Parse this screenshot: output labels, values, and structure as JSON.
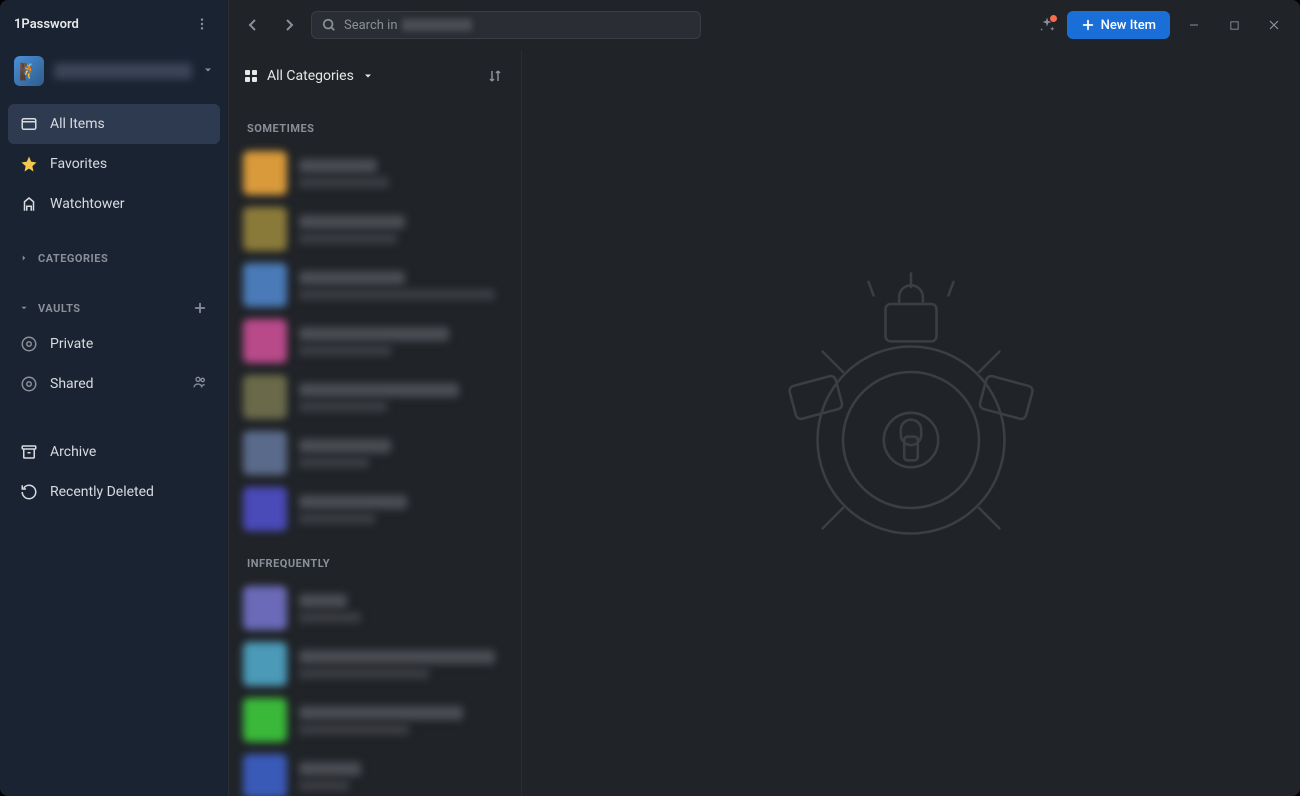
{
  "app_title": "1Password",
  "account_name": "",
  "search_prefix": "Search in",
  "new_item_label": "New Item",
  "nav": {
    "all_items": "All Items",
    "favorites": "Favorites",
    "watchtower": "Watchtower",
    "archive": "Archive",
    "recently_deleted": "Recently Deleted"
  },
  "sections": {
    "categories": "CATEGORIES",
    "vaults": "VAULTS"
  },
  "vaults": {
    "private": "Private",
    "shared": "Shared"
  },
  "list_header": {
    "category": "All Categories"
  },
  "groups": [
    {
      "label": "SOMETIMES",
      "items": [
        {
          "icon_color": "#d89a3a",
          "title_w": 78,
          "sub_w": 90
        },
        {
          "icon_color": "#8a7a3a",
          "title_w": 106,
          "sub_w": 98
        },
        {
          "icon_color": "#4a7ab8",
          "title_w": 106,
          "sub_w": 196
        },
        {
          "icon_color": "#b84a8a",
          "title_w": 150,
          "sub_w": 92
        },
        {
          "icon_color": "#6a6a4a",
          "title_w": 160,
          "sub_w": 88
        },
        {
          "icon_color": "#5a6a8a",
          "title_w": 92,
          "sub_w": 70
        },
        {
          "icon_color": "#4a4ab8",
          "title_w": 108,
          "sub_w": 76
        }
      ]
    },
    {
      "label": "INFREQUENTLY",
      "items": [
        {
          "icon_color": "#6a6ab8",
          "title_w": 48,
          "sub_w": 62
        },
        {
          "icon_color": "#4a9ab8",
          "title_w": 196,
          "sub_w": 130
        },
        {
          "icon_color": "#3ab83a",
          "title_w": 164,
          "sub_w": 110
        },
        {
          "icon_color": "#3a5ab8",
          "title_w": 62,
          "sub_w": 50
        }
      ]
    }
  ],
  "colors": {
    "accent": "#1a6ed8",
    "notif": "#ff6b4a"
  }
}
